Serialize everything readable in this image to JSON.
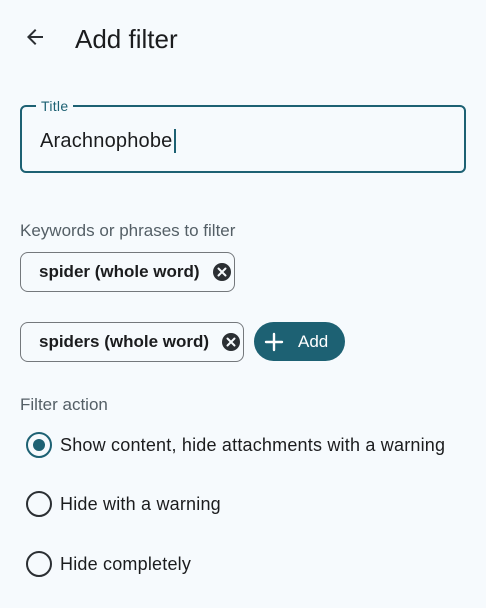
{
  "header": {
    "back_icon": "arrow-back-icon",
    "title": "Add filter"
  },
  "title_field": {
    "label": "Title",
    "value": "Arachnophobe"
  },
  "keywords": {
    "label": "Keywords or phrases to filter",
    "chips": [
      {
        "label": "spider (whole word)",
        "icon": "close-circle-icon"
      },
      {
        "label": "spiders (whole word)",
        "icon": "close-circle-icon"
      }
    ],
    "add_button": {
      "label": "Add",
      "icon": "plus-icon"
    }
  },
  "filter_action": {
    "label": "Filter action",
    "options": [
      {
        "label": "Show content, hide attachments with a warning",
        "selected": true
      },
      {
        "label": "Hide with a warning",
        "selected": false
      },
      {
        "label": "Hide completely",
        "selected": false
      }
    ]
  },
  "colors": {
    "accent": "#1d6173",
    "background": "#f6fafd",
    "text": "#1b1c1e",
    "muted_text": "#545f66",
    "chip_border": "#74787c"
  }
}
